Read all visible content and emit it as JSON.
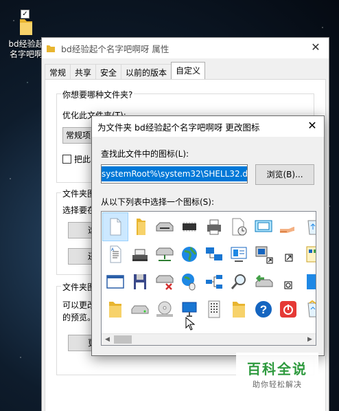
{
  "desktop": {
    "folder_label": "bd经验起个名字吧啊呀",
    "folder_label_line1": "bd经验起",
    "folder_label_line2": "名字吧啊"
  },
  "properties": {
    "title": "bd经验起个名字吧啊呀 属性",
    "tabs": [
      "常规",
      "共享",
      "安全",
      "以前的版本",
      "自定义"
    ],
    "active_tab": "自定义",
    "group1_label": "你想要哪种文件夹?",
    "optimize_label": "优化此文件夹(T):",
    "optimize_value": "常规项",
    "checkbox_label": "把此",
    "group2_label": "文件夹图",
    "group2_text": "选择要在",
    "btn_choose": "选择",
    "btn_restore": "还原",
    "group3_label": "文件夹图",
    "group3_text1": "可以更改",
    "group3_text2": "的预览。",
    "btn_change": "更改"
  },
  "dialog": {
    "title": "为文件夹 bd经验起个名字吧啊呀 更改图标",
    "find_label": "查找此文件中的图标(L):",
    "path_value": "%SystemRoot%\\system32\\SHELL32.dll",
    "path_visible": "systemRoot%\\system32\\SHELL32.dll",
    "browse_label": "浏览(B)...",
    "list_label": "从以下列表中选择一个图标(S):",
    "icons": [
      "blank-document-icon",
      "folder-icon",
      "floppy-drive-icon",
      "chip-icon",
      "printer-icon",
      "document-clock-icon",
      "display-icon",
      "hand-share-icon",
      "recycle-bin-empty-icon",
      "text-document-icon",
      "printer-desktop-icon",
      "network-drive-icon",
      "globe-icon",
      "network-computers-icon",
      "control-panel-icon",
      "computer-shortcut-icon",
      "shortcut-arrow-icon",
      "program-group-icon",
      "window-icon",
      "save-disk-icon",
      "network-drive-disconnected-icon",
      "globe-mouse-icon",
      "network-icon",
      "magnifier-icon",
      "drive-arrow-icon",
      "clock-small-icon",
      "blue-panel-icon",
      "folder-icon",
      "hard-drive-icon",
      "cd-drive-icon",
      "monitor-icon",
      "file-grid-icon",
      "folder-icon",
      "help-icon",
      "power-icon",
      "recycle-bin-full-icon",
      "folder-tree-icon"
    ]
  },
  "watermark": {
    "line1": "百科全说",
    "line2": "助你轻松解决"
  }
}
